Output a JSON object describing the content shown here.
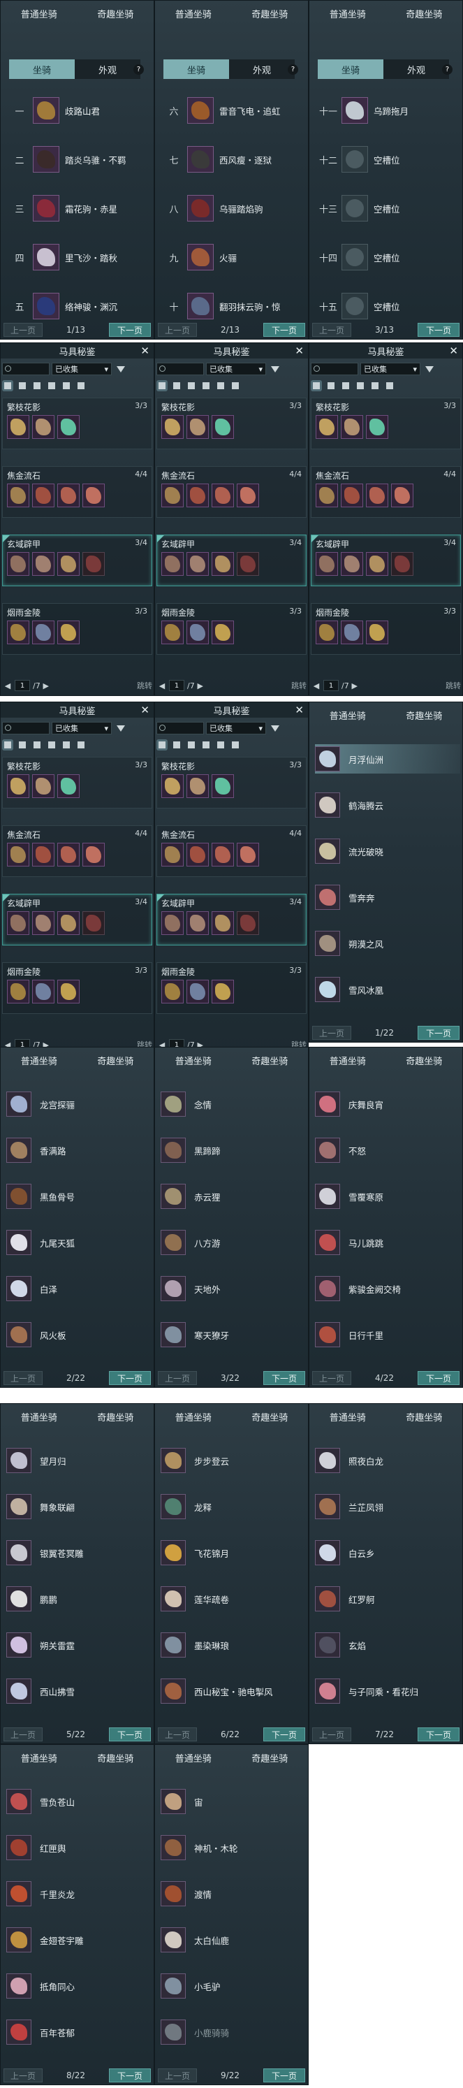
{
  "category_tabs": {
    "normal": "普通坐骑",
    "fun": "奇趣坐骑"
  },
  "sub_tabs": {
    "mount": "坐骑",
    "appearance": "外观",
    "help": "?"
  },
  "pager": {
    "prev": "上一页",
    "next": "下一页"
  },
  "mount_pages": [
    {
      "page": "1/13",
      "rows": [
        {
          "num": "一",
          "name": "歧路山君",
          "color": "#a07a3a"
        },
        {
          "num": "二",
          "name": "踏炎乌骓・不羁",
          "color": "#3a2a2a"
        },
        {
          "num": "三",
          "name": "霜花驹・赤星",
          "color": "#8a2a3a"
        },
        {
          "num": "四",
          "name": "里飞沙・踏秋",
          "color": "#c8c0d0"
        },
        {
          "num": "五",
          "name": "络神骏・渊沉",
          "color": "#2a3a7a"
        }
      ]
    },
    {
      "page": "2/13",
      "rows": [
        {
          "num": "六",
          "name": "雷音飞电・追虹",
          "color": "#9a5a2a"
        },
        {
          "num": "七",
          "name": "西风瘦・逐狱",
          "color": "#3a3a3a"
        },
        {
          "num": "八",
          "name": "乌骊踏焰驹",
          "color": "#7a2a2a"
        },
        {
          "num": "九",
          "name": "火骊",
          "color": "#a05a3a"
        },
        {
          "num": "十",
          "name": "翻羽抹云驹・惊",
          "color": "#5a6a8a"
        }
      ]
    },
    {
      "page": "3/13",
      "rows": [
        {
          "num": "十一",
          "name": "乌蹄拖月",
          "color": "#c0c8d0"
        },
        {
          "num": "十二",
          "name": "空槽位",
          "color": "#4b5b61",
          "empty": true
        },
        {
          "num": "十三",
          "name": "空槽位",
          "color": "#4b5b61",
          "empty": true
        },
        {
          "num": "十四",
          "name": "空槽位",
          "color": "#4b5b61",
          "empty": true
        },
        {
          "num": "十五",
          "name": "空槽位",
          "color": "#4b5b61",
          "empty": true
        }
      ]
    }
  ],
  "saddle": {
    "title": "马具秘鉴",
    "close": "✕",
    "filter": "已收集",
    "dropdown_arrow": "▾",
    "jump": "跳转",
    "page_input": "1",
    "page_total": "/7",
    "sets": [
      {
        "name": "繁枝花影",
        "count": "3/3",
        "items": [
          "#c0a060",
          "#b09070",
          "#60c0a0"
        ]
      },
      {
        "name": "焦金流石",
        "count": "4/4",
        "items": [
          "#a08050",
          "#a05040",
          "#b06050",
          "#c07060"
        ]
      },
      {
        "name": "玄域辟甲",
        "count": "3/4",
        "items": [
          "#907060",
          "#a08070",
          "#b09060",
          "#7a3a3a"
        ],
        "highlight": true
      },
      {
        "name": "烟雨金陵",
        "count": "3/3",
        "items": [
          "#a08040",
          "#7080a0",
          "#c0a050"
        ]
      }
    ]
  },
  "fun_pages": [
    {
      "page": "1/22",
      "items": [
        {
          "name": "月浮仙洲",
          "color": "#c0d0e0",
          "selected": true
        },
        {
          "name": "鹤海腾云",
          "color": "#d0c8c0"
        },
        {
          "name": "流光破晓",
          "color": "#c8c0a0"
        },
        {
          "name": "雪奔奔",
          "color": "#c07070"
        },
        {
          "name": "朔漠之风",
          "color": "#a09080"
        },
        {
          "name": "雪风冰凰",
          "color": "#c0d8e8"
        }
      ]
    },
    {
      "page": "2/22",
      "items": [
        {
          "name": "龙宫探骊",
          "color": "#a0b0d0"
        },
        {
          "name": "香满路",
          "color": "#a08060"
        },
        {
          "name": "黑鱼骨号",
          "color": "#805030"
        },
        {
          "name": "九尾天狐",
          "color": "#e0e0e8"
        },
        {
          "name": "白泽",
          "color": "#d0d8e8"
        },
        {
          "name": "风火板",
          "color": "#a07050"
        }
      ]
    },
    {
      "page": "3/22",
      "items": [
        {
          "name": "念情",
          "color": "#a0a080"
        },
        {
          "name": "黑蹄蹄",
          "color": "#806050"
        },
        {
          "name": "赤云狸",
          "color": "#a09070"
        },
        {
          "name": "八方游",
          "color": "#907050"
        },
        {
          "name": "天地外",
          "color": "#b0a0b0"
        },
        {
          "name": "寒天獠牙",
          "color": "#8090a0"
        }
      ]
    },
    {
      "page": "4/22",
      "items": [
        {
          "name": "庆舞良宵",
          "color": "#d07080"
        },
        {
          "name": "不怒",
          "color": "#a07070"
        },
        {
          "name": "雪覆寒原",
          "color": "#d0d0d8"
        },
        {
          "name": "马儿跳跳",
          "color": "#c05050"
        },
        {
          "name": "紫骏金阙交椅",
          "color": "#a06070"
        },
        {
          "name": "日行千里",
          "color": "#b05040"
        }
      ]
    },
    {
      "page": "5/22",
      "items": [
        {
          "name": "望月归",
          "color": "#c0c0d0"
        },
        {
          "name": "舞象联翩",
          "color": "#c0b0a0"
        },
        {
          "name": "银翼苍冥雕",
          "color": "#c8c8d0"
        },
        {
          "name": "鹏鹏",
          "color": "#e0e0e0"
        },
        {
          "name": "朔关雷霆",
          "color": "#d0c0e0"
        },
        {
          "name": "西山拂雪",
          "color": "#c0c8e0"
        }
      ]
    },
    {
      "page": "6/22",
      "items": [
        {
          "name": "步步登云",
          "color": "#b09060"
        },
        {
          "name": "龙释",
          "color": "#508070"
        },
        {
          "name": "飞花锦月",
          "color": "#d0a040"
        },
        {
          "name": "莲华疏卷",
          "color": "#d0c0b0"
        },
        {
          "name": "墨染琳琅",
          "color": "#8090a0"
        },
        {
          "name": "西山秘宝・驰电掣风",
          "color": "#a06040"
        }
      ]
    },
    {
      "page": "7/22",
      "items": [
        {
          "name": "照夜白龙",
          "color": "#d0d0d8"
        },
        {
          "name": "兰芷凤翎",
          "color": "#a07050"
        },
        {
          "name": "白云乡",
          "color": "#d0d8e8"
        },
        {
          "name": "红罗舸",
          "color": "#a05040"
        },
        {
          "name": "玄焰",
          "color": "#505060"
        },
        {
          "name": "与子同乘・看花归",
          "color": "#d08090"
        }
      ]
    },
    {
      "page": "8/22",
      "items": [
        {
          "name": "雪负苍山",
          "color": "#c05050"
        },
        {
          "name": "红匣舆",
          "color": "#a04030"
        },
        {
          "name": "千里炎龙",
          "color": "#c05030"
        },
        {
          "name": "金翅苍宇雕",
          "color": "#c09040"
        },
        {
          "name": "抵角同心",
          "color": "#d0a0b0"
        },
        {
          "name": "百年苍郁",
          "color": "#c04040"
        }
      ]
    },
    {
      "page": "9/22",
      "items": [
        {
          "name": "宙",
          "color": "#c0a080"
        },
        {
          "name": "神机・木轮",
          "color": "#906040"
        },
        {
          "name": "渡情",
          "color": "#a05030"
        },
        {
          "name": "太白仙鹿",
          "color": "#d0c8c0"
        },
        {
          "name": "小毛驴",
          "color": "#8090a0"
        },
        {
          "name": "小鹿骑骑",
          "color": "#707880",
          "dim": true
        }
      ]
    }
  ]
}
